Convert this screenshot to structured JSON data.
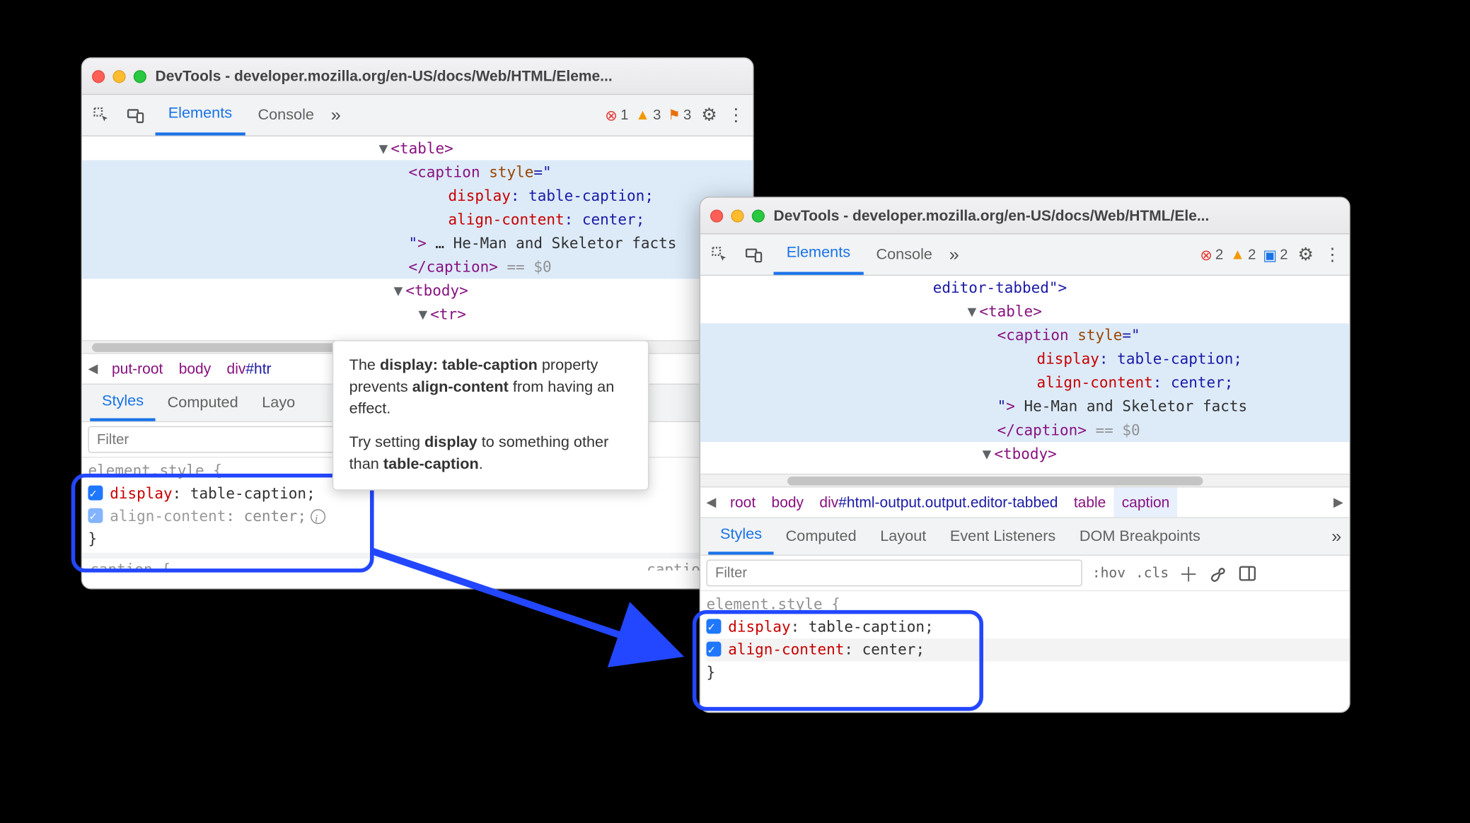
{
  "win1": {
    "title": "DevTools - developer.mozilla.org/en-US/docs/Web/HTML/Eleme...",
    "tabs": {
      "elements": "Elements",
      "console": "Console"
    },
    "status": {
      "errors": "1",
      "warnings": "3",
      "flags": "3"
    },
    "dom": {
      "table_open": "<table>",
      "caption_open": "<caption",
      "style_attr": "style",
      "style_eq": "=\"",
      "prop1": "display",
      "val1": "table-caption",
      "prop2": "align-content",
      "val2": "center",
      "close_q": "\">",
      "caption_text": "He-Man and Skeletor facts",
      "caption_close": "</caption>",
      "eq_dollar": "== $0",
      "tbody": "<tbody>",
      "tr": "<tr>"
    },
    "crumbs": {
      "c1": "put-root",
      "c2": "body",
      "c3": "div#htr"
    },
    "subtabs": {
      "styles": "Styles",
      "computed": "Computed",
      "layout": "Layo"
    },
    "filter_placeholder": "Filter",
    "rule": {
      "selector": "element.style {",
      "p1": "display",
      "v1": "table-caption",
      "p2": "align-content",
      "v2": "center",
      "close": "}"
    },
    "tooltip": {
      "l1a": "The ",
      "l1b": "display: table-caption",
      "l1c": " property prevents ",
      "l1d": "align-content",
      "l1e": " from having an effect.",
      "l2a": "Try setting ",
      "l2b": "display",
      "l2c": " to something other than ",
      "l2d": "table-caption",
      "l2e": "."
    }
  },
  "win2": {
    "title": "DevTools - developer.mozilla.org/en-US/docs/Web/HTML/Ele...",
    "tabs": {
      "elements": "Elements",
      "console": "Console"
    },
    "status": {
      "errors": "2",
      "warnings": "2",
      "issues": "2"
    },
    "dom": {
      "prev_line": "editor-tabbed\">",
      "table_open": "<table>",
      "caption_open": "<caption",
      "style_attr": "style",
      "style_eq": "=\"",
      "prop1": "display",
      "val1": "table-caption",
      "prop2": "align-content",
      "val2": "center",
      "close_q": "\">",
      "caption_text": "He-Man and Skeletor facts",
      "caption_close": "</caption>",
      "eq_dollar": "== $0",
      "tbody": "<tbody>"
    },
    "crumbs": {
      "c1": "root",
      "c2": "body",
      "c3": "div#html-output.output.editor-tabbed",
      "c4": "table",
      "c5": "caption"
    },
    "subtabs": {
      "styles": "Styles",
      "computed": "Computed",
      "layout": "Layout",
      "ev": "Event Listeners",
      "dom": "DOM Breakpoints"
    },
    "filter_placeholder": "Filter",
    "hov": ":hov",
    "cls": ".cls",
    "rule": {
      "selector": "element.style {",
      "p1": "display",
      "v1": "table-caption",
      "p2": "align-content",
      "v2": "center",
      "close": "}"
    }
  }
}
